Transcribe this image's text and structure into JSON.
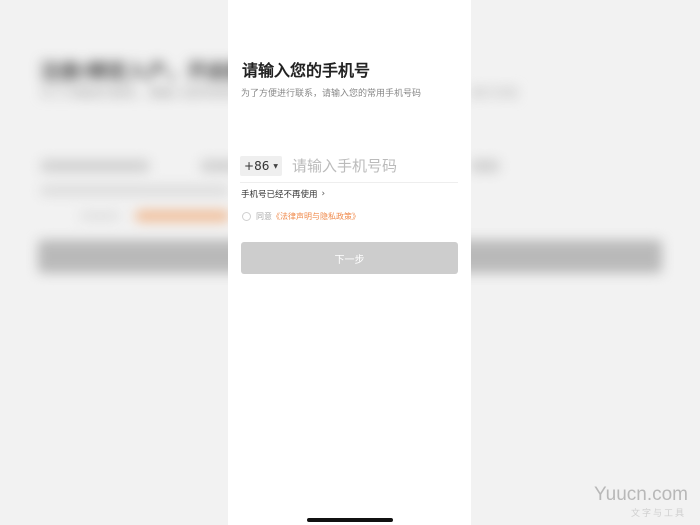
{
  "background": {
    "title": "注册/绑定入户，开启服务",
    "subtitle": "为了方便进行联系，请输入您的常用手机号码",
    "subtitle_right": "进行识别"
  },
  "modal": {
    "title": "请输入您的手机号",
    "subtitle": "为了方便进行联系，请输入您的常用手机号码",
    "country_code": "+86",
    "phone_placeholder": "请输入手机号码",
    "no_longer_used": "手机号已经不再使用",
    "agree_prefix": "同意",
    "agree_link": "《法律声明与隐私政策》",
    "next_button": "下一步"
  },
  "watermark": {
    "text": "Yuucn.com",
    "sub": "文字与工具"
  },
  "colors": {
    "link": "#f08a4b",
    "button_disabled": "#cdcdcd"
  }
}
